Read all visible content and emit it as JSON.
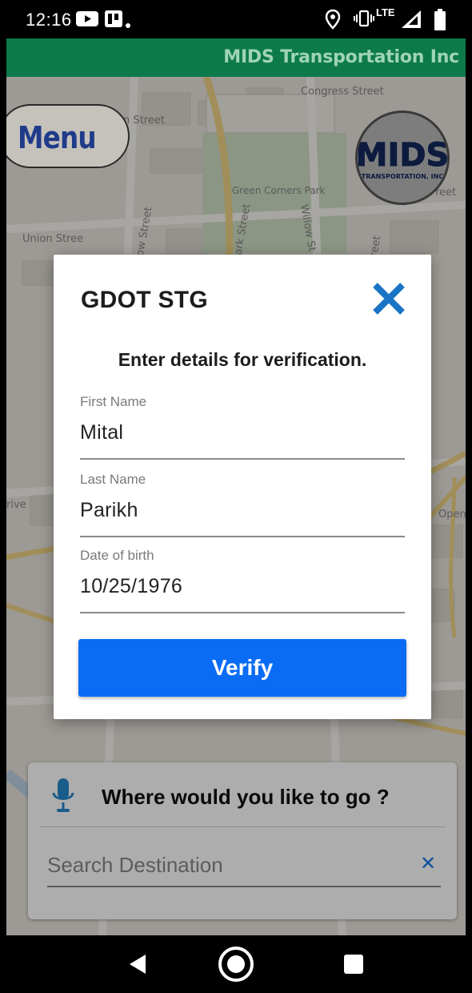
{
  "status_bar": {
    "time": "12:16",
    "network": "LTE",
    "icons": [
      "youtube-icon",
      "trello-icon",
      "dot-icon",
      "location-icon",
      "vibrate-icon",
      "signal-icon",
      "battery-icon"
    ]
  },
  "app_bar": {
    "title": "MIDS Transportation Inc",
    "color": "#0d7a4c"
  },
  "map": {
    "street_labels": [
      "Congress Street",
      "een Street",
      "Green Corners Park",
      "Union Stree",
      "low Street",
      "Park Street",
      "Willow St",
      "treet",
      "reet",
      "rive",
      "Open"
    ]
  },
  "menu_button": {
    "label": "Menu"
  },
  "logo": {
    "line1": "MIDS",
    "line2": "TRANSPORTATION, INC"
  },
  "dialog": {
    "title": "GDOT STG",
    "close_icon": "close-icon",
    "subtitle": "Enter details for verification.",
    "fields": [
      {
        "label": "First Name",
        "value": "Mital"
      },
      {
        "label": "Last Name",
        "value": "Parikh"
      },
      {
        "label": "Date of birth",
        "value": "10/25/1976"
      }
    ],
    "verify_label": "Verify",
    "accent": "#0a6cf5",
    "close_color": "#1a74c6"
  },
  "search_card": {
    "question": "Where would you like to go ?",
    "placeholder": "Search Destination",
    "clear_icon": "close-icon",
    "mic_icon": "microphone-icon"
  },
  "nav_bar": {
    "buttons": [
      "back-icon",
      "home-icon",
      "recents-icon"
    ]
  }
}
